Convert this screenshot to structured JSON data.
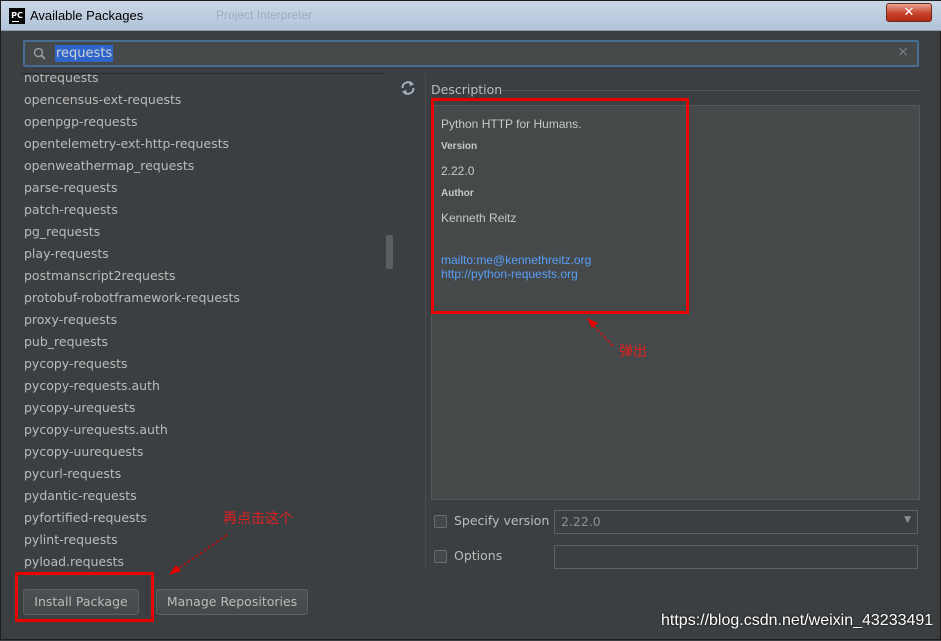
{
  "window": {
    "title": "Available Packages",
    "app_icon_label": "PC",
    "background_title": "Project Interpreter",
    "close_label": "✕"
  },
  "search": {
    "value": "requests",
    "clear_label": "×"
  },
  "packages": [
    "notrequests",
    "opencensus-ext-requests",
    "openpgp-requests",
    "opentelemetry-ext-http-requests",
    "openweathermap_requests",
    "parse-requests",
    "patch-requests",
    "pg_requests",
    "play-requests",
    "postmanscript2requests",
    "protobuf-robotframework-requests",
    "proxy-requests",
    "pub_requests",
    "pycopy-requests",
    "pycopy-requests.auth",
    "pycopy-urequests",
    "pycopy-urequests.auth",
    "pycopy-uurequests",
    "pycurl-requests",
    "pydantic-requests",
    "pyfortified-requests",
    "pylint-requests",
    "pyload.requests"
  ],
  "description": {
    "label": "Description",
    "summary": "Python HTTP for Humans.",
    "version_heading": "Version",
    "version": "2.22.0",
    "author_heading": "Author",
    "author": "Kenneth Reitz",
    "links": [
      "mailto:me@kennethreitz.org",
      "http://python-requests.org"
    ]
  },
  "options": {
    "specify_version_label": "Specify version",
    "specify_version_value": "2.22.0",
    "options_label": "Options",
    "options_value": ""
  },
  "buttons": {
    "install": "Install Package",
    "manage": "Manage Repositories"
  },
  "annotations": {
    "popup_note": "弹出",
    "click_note": "再点击这个",
    "color": "#e60000"
  },
  "watermark": "https://blog.csdn.net/weixin_43233491",
  "colors": {
    "background": "#3c3f41",
    "selection": "#2f65ca",
    "link": "#589df6"
  }
}
